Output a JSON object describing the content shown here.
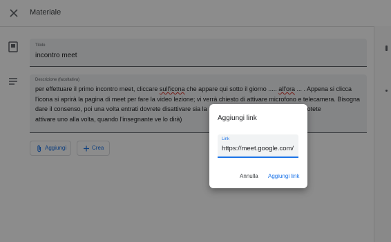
{
  "header": {
    "title": "Materiale",
    "close_icon": "close-icon"
  },
  "form": {
    "title_label": "Titolo",
    "title_value": "incontro meet",
    "description_label": "Descrizione (facoltativa)",
    "description_lines": [
      [
        "per effettuare il primo incontro meet, cliccare ",
        "sull'icona",
        " che appare qui sotto il giorno ..... ",
        "all'ora",
        " ... . Appena si clicca"
      ],
      [
        "l'icona si aprirà la pagina di meet per fare la video lezione; vi verrà chiesto di attivare microfono e telecamera. Bisogna"
      ],
      [
        "dare il consenso, poi una volta entrati dovrete disattivare sia la te",
        "",
        "",
        "",
        "no lo potete"
      ],
      [
        "attivare uno alla volta, quando l'insegnante ve lo dirà)"
      ]
    ],
    "add_button": "Aggiungi",
    "create_button": "Crea"
  },
  "dialog": {
    "title": "Aggiungi link",
    "link_label": "Link",
    "link_value": "https://meet.google.com/",
    "cancel": "Annulla",
    "confirm": "Aggiungi link"
  },
  "colors": {
    "accent": "#1a73e8",
    "field_bg": "#f1f3f4",
    "scrim": "rgba(0,0,0,0.45)"
  }
}
